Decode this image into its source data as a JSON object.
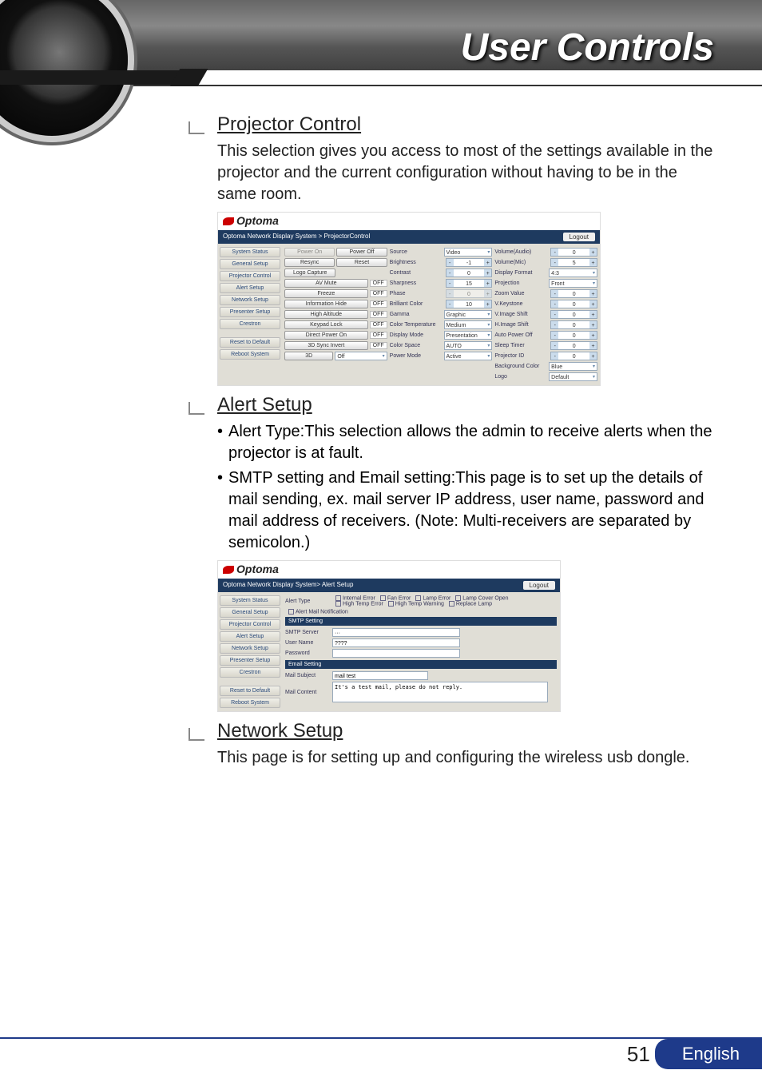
{
  "header": {
    "title": "User Controls"
  },
  "sections": {
    "projector_control": {
      "title": "Projector Control",
      "body": "This selection gives you access to most of the settings available in the projector and the current configuration without having to be in the same room."
    },
    "alert_setup": {
      "title": "Alert Setup",
      "b1": "Alert Type:This selection allows the admin to receive alerts when the projector is at fault.",
      "b2": "SMTP setting and Email setting:This page is to set up the details of mail sending, ex. mail server IP address, user name, password and mail address of receivers. (Note: Multi-receivers are separated by semicolon.)"
    },
    "network_setup": {
      "title": "Network Setup",
      "body": "This page is for setting up and configuring the wireless usb dongle."
    }
  },
  "shot1": {
    "brand": "Optoma",
    "breadcrumb": "Optoma Network Display System > ProjectorControl",
    "logout": "Logout",
    "sidebar": [
      "System Status",
      "General Setup",
      "Projector Control",
      "Alert Setup",
      "Network Setup",
      "Presenter Setup",
      "Crestron",
      "",
      "Reset to Default",
      "Reboot System"
    ],
    "col1": {
      "power_on": "Power On",
      "power_off": "Power Off",
      "resync": "Resync",
      "reset": "Reset",
      "logo_capture": "Logo Capture",
      "av_mute": "AV Mute",
      "freeze": "Freeze",
      "info_hide": "Information Hide",
      "high_alt": "High Altitude",
      "keypad_lock": "Keypad Lock",
      "direct_power": "Direct Power On",
      "sync_invert": "3D Sync Invert",
      "three_d": "3D",
      "three_d_val": "Off",
      "off_tag": "OFF"
    },
    "col2": {
      "source": "Source",
      "source_v": "Video",
      "brightness": "Brightness",
      "brightness_v": "-1",
      "contrast": "Contrast",
      "contrast_v": "0",
      "sharpness": "Sharpness",
      "sharpness_v": "15",
      "phase": "Phase",
      "phase_v": "0",
      "brilliant": "Brilliant Color",
      "brilliant_v": "10",
      "gamma": "Gamma",
      "gamma_v": "Graphic",
      "ctemp": "Color Temperature",
      "ctemp_v": "Medium",
      "dmode": "Display Mode",
      "dmode_v": "Presentation",
      "cspace": "Color Space",
      "cspace_v": "AUTO",
      "pmode": "Power Mode",
      "pmode_v": "Active"
    },
    "col3": {
      "vol_a": "Volume(Audio)",
      "vol_a_v": "0",
      "vol_m": "Volume(Mic)",
      "vol_m_v": "5",
      "dfmt": "Display Format",
      "dfmt_v": "4:3",
      "proj": "Projection",
      "proj_v": "Front",
      "zoom": "Zoom Value",
      "zoom_v": "0",
      "vkey": "V.Keystone",
      "vkey_v": "0",
      "vshift": "V.Image Shift",
      "vshift_v": "0",
      "hshift": "H.Image Shift",
      "hshift_v": "0",
      "apo": "Auto Power Off",
      "apo_v": "0",
      "sleep": "Sleep Timer",
      "sleep_v": "0",
      "pid": "Projector ID",
      "pid_v": "0",
      "bg": "Background Color",
      "bg_v": "Blue",
      "logo": "Logo",
      "logo_v": "Default"
    }
  },
  "shot2": {
    "brand": "Optoma",
    "breadcrumb": "Optoma Network Display System> Alert Setup",
    "logout": "Logout",
    "sidebar": [
      "System Status",
      "General Setup",
      "Projector Control",
      "Alert Setup",
      "Network Setup",
      "Presenter Setup",
      "Crestron",
      "",
      "Reset to Default",
      "Reboot System"
    ],
    "alert_type_lbl": "Alert Type",
    "chk_line1": [
      "Internal Error",
      "Fan Error",
      "Lamp Error",
      "Lamp Cover Open"
    ],
    "chk_line2": [
      "High Temp Error",
      "High Temp Warning",
      "Replace Lamp"
    ],
    "alert_mail_chk": "Alert Mail Notification",
    "smtp_h": "SMTP Setting",
    "smtp_server_lbl": "SMTP Server",
    "smtp_server_v": "···",
    "user_lbl": "User Name",
    "user_v": "????",
    "pass_lbl": "Password",
    "pass_v": "",
    "email_h": "Email Setting",
    "subj_lbl": "Mail Subject",
    "subj_v": "mail test",
    "content_lbl": "Mail Content",
    "content_v": "It's a test mail, please do not reply."
  },
  "footer": {
    "page": "51",
    "lang": "English"
  }
}
